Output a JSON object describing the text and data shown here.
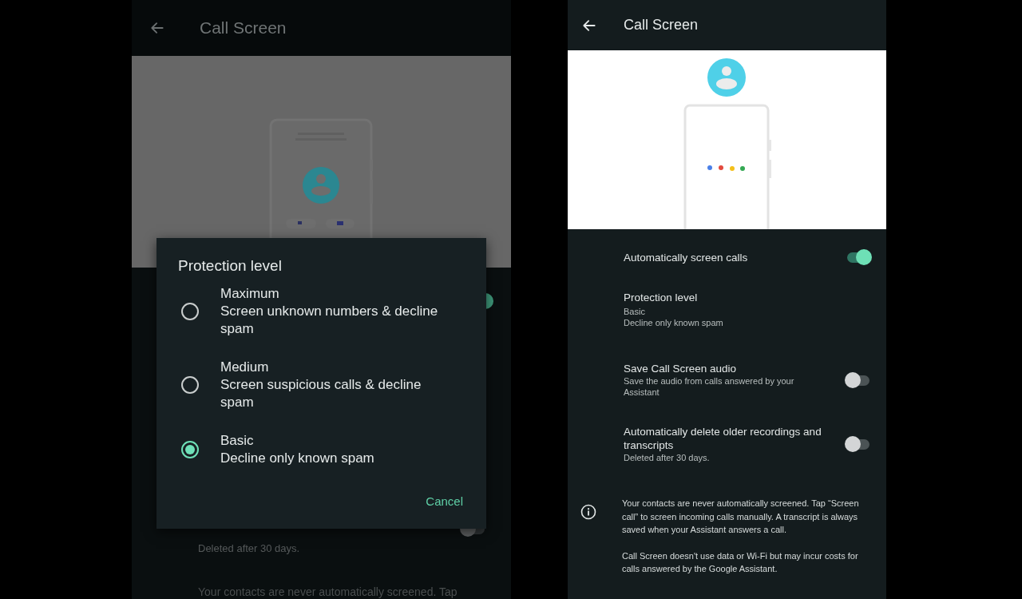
{
  "left_screen": {
    "title": "Call Screen",
    "settings_behind": [
      {
        "kind": "toggle",
        "on": true
      },
      {
        "kind": "toggle",
        "subtitle": "Deleted after 30 days.",
        "on": false
      }
    ],
    "footer_note": "Your contacts are never automatically screened. Tap",
    "dialog": {
      "title": "Protection level",
      "options": [
        {
          "label": "Maximum",
          "description": "Screen unknown numbers & decline spam",
          "selected": false
        },
        {
          "label": "Medium",
          "description": "Screen suspicious calls & decline spam",
          "selected": false
        },
        {
          "label": "Basic",
          "description": "Decline only known spam",
          "selected": true
        }
      ],
      "cancel": "Cancel"
    }
  },
  "right_screen": {
    "title": "Call Screen",
    "settings": [
      {
        "kind": "toggle",
        "title": "Automatically screen calls",
        "on": true
      },
      {
        "kind": "choice",
        "title": "Protection level",
        "subtitles": [
          "Basic",
          "Decline only known spam"
        ]
      },
      {
        "kind": "toggle",
        "title": "Save Call Screen audio",
        "subtitles": [
          "Save the audio from calls answered by your Assistant"
        ],
        "on": false
      },
      {
        "kind": "toggle",
        "title": "Automatically delete older recordings and transcripts",
        "subtitles": [
          "Deleted after 30 days."
        ],
        "on": false
      }
    ],
    "info_notes": [
      "Your contacts are never automatically screened. Tap “Screen call” to screen incoming calls manually. A transcript is always saved when your Assistant answers a call.",
      "Call Screen doesn't use data or Wi-Fi but may incur costs for calls answered by the Google Assistant."
    ]
  }
}
